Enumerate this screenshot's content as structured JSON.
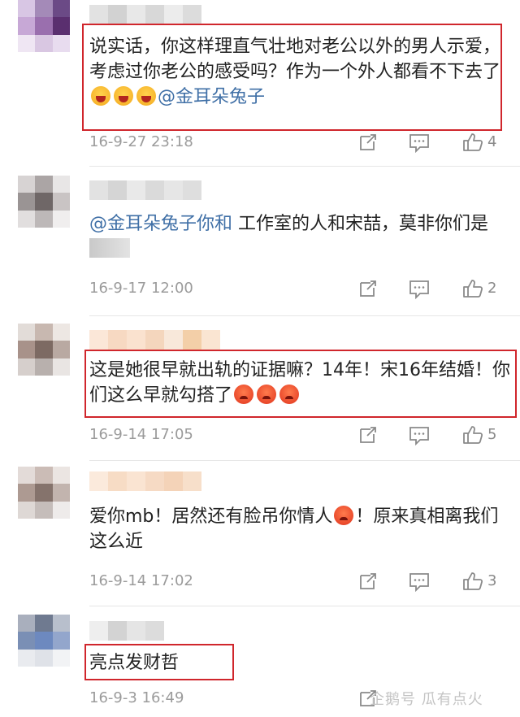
{
  "comments": [
    {
      "text_a": "说实话，你这样理直气壮地对老公以外的男人示爱，考虑过你老公的感受吗？作为一个外人都看不下去了",
      "mention": "@金耳朵兔子",
      "time": "16-9-27 23:18",
      "likes": "4",
      "emoji": "cry-icon"
    },
    {
      "mention": "@金耳朵兔子你和",
      "text_a": " 工作室的人和宋喆，莫非你们是",
      "time": "16-9-17 12:00",
      "likes": "2"
    },
    {
      "text_a": "这是她很早就出轨的证据嘛？14年！宋16年结婚！你们这么早就勾搭了",
      "time": "16-9-14 17:05",
      "likes": "5",
      "emoji": "angry-icon"
    },
    {
      "text_a": "爱你mb！居然还有脸吊你情人",
      "text_b": "！原来真相离我们这么近",
      "time": "16-9-14 17:02",
      "likes": "3",
      "emoji": "angry-icon"
    },
    {
      "text_a": "亮点发财哲",
      "time": "16-9-3 16:49"
    }
  ],
  "watermark": "企鹅号 瓜有点火",
  "colors": {
    "highlight_box": "#d0262c",
    "mention": "#3f6fa6",
    "meta": "#9b9b9b"
  }
}
